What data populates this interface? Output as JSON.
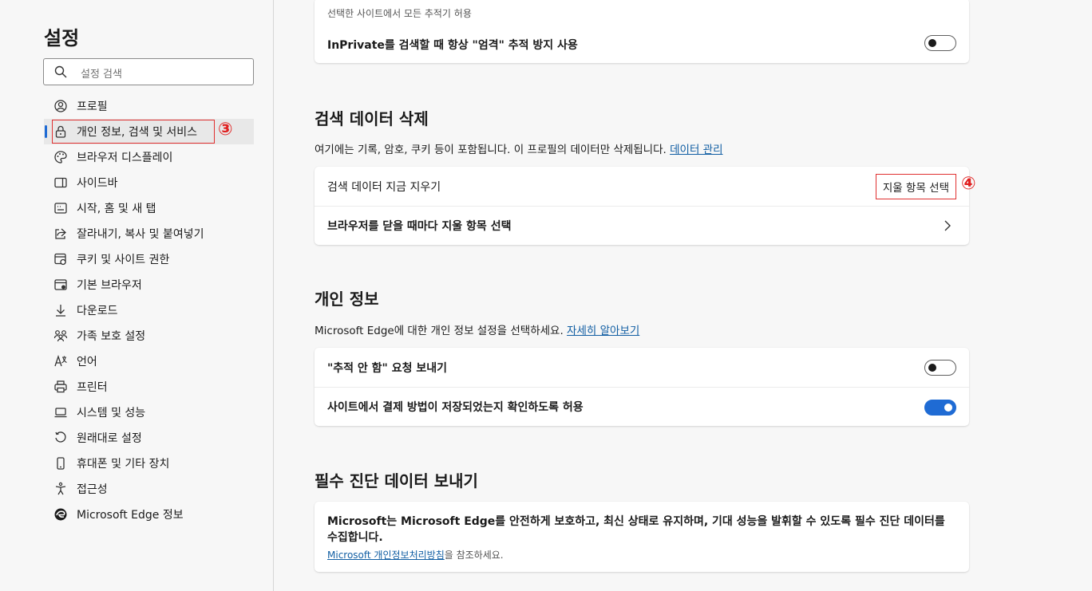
{
  "sidebar": {
    "title": "설정",
    "search_placeholder": "설정 검색",
    "items": [
      {
        "label": "프로필",
        "icon": "profile-icon"
      },
      {
        "label": "개인 정보, 검색 및 서비스",
        "icon": "lock-icon"
      },
      {
        "label": "브라우저 디스플레이",
        "icon": "palette-icon"
      },
      {
        "label": "사이드바",
        "icon": "sidebar-icon"
      },
      {
        "label": "시작, 홈 및 새 탭",
        "icon": "home-tab-icon"
      },
      {
        "label": "잘라내기, 복사 및 붙여넣기",
        "icon": "share-icon"
      },
      {
        "label": "쿠키 및 사이트 권한",
        "icon": "cookie-permissions-icon"
      },
      {
        "label": "기본 브라우저",
        "icon": "default-browser-icon"
      },
      {
        "label": "다운로드",
        "icon": "download-icon"
      },
      {
        "label": "가족 보호 설정",
        "icon": "family-icon"
      },
      {
        "label": "언어",
        "icon": "language-icon"
      },
      {
        "label": "프린터",
        "icon": "printer-icon"
      },
      {
        "label": "시스템 및 성능",
        "icon": "laptop-icon"
      },
      {
        "label": "원래대로 설정",
        "icon": "reset-icon"
      },
      {
        "label": "휴대폰 및 기타 장치",
        "icon": "phone-icon"
      },
      {
        "label": "접근성",
        "icon": "accessibility-icon"
      },
      {
        "label": "Microsoft Edge 정보",
        "icon": "edge-logo-icon"
      }
    ],
    "active_index": 1,
    "marker": "③"
  },
  "top_card": {
    "subtext": "선택한 사이트에서 모든 추적기 허용",
    "inprivate_label": "InPrivate를 검색할 때 항상 \"엄격\" 추적 방지 사용",
    "inprivate_on": false
  },
  "clear_data": {
    "heading": "검색 데이터 삭제",
    "desc": "여기에는 기록, 암호, 쿠키 등이 포함됩니다. 이 프로필의 데이터만 삭제됩니다.",
    "desc_link": "데이터 관리",
    "row1_label": "검색 데이터 지금 지우기",
    "row1_button": "지울 항목 선택",
    "row2_label": "브라우저를 닫을 때마다 지울 항목 선택",
    "marker": "④"
  },
  "privacy": {
    "heading": "개인 정보",
    "desc": "Microsoft Edge에 대한 개인 정보 설정을 선택하세요.",
    "desc_link": "자세히 알아보기",
    "dnt_label": "\"추적 안 함\" 요청 보내기",
    "dnt_on": false,
    "payment_label": "사이트에서 결제 방법이 저장되었는지 확인하도록 허용",
    "payment_on": true
  },
  "diagnostics": {
    "heading": "필수 진단 데이터 보내기",
    "body": "Microsoft는 Microsoft Edge를 안전하게 보호하고, 최신 상태로 유지하며, 기대 성능을 발휘할 수 있도록 필수 진단 데이터를 수집합니다.",
    "link": "Microsoft 개인정보처리방침",
    "link_suffix": "을 참조하세요."
  }
}
